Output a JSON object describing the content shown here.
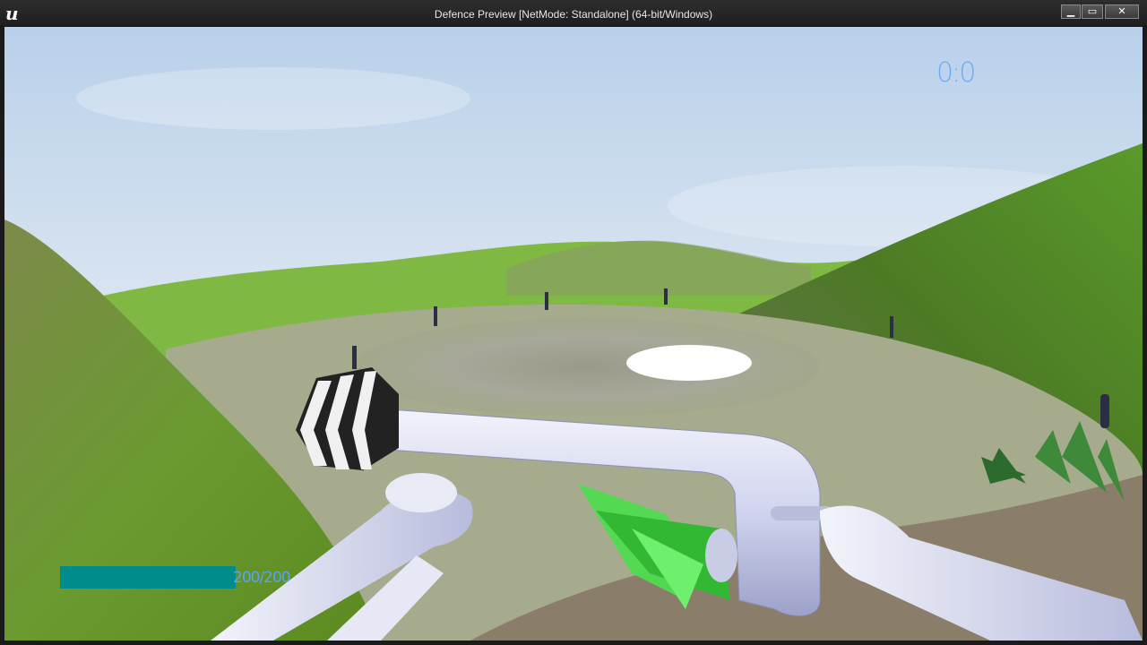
{
  "window": {
    "logo": "u",
    "title": "Defence Preview [NetMode: Standalone]  (64-bit/Windows)",
    "minimize_glyph": "▁",
    "maximize_glyph": "▭",
    "close_glyph": "✕"
  },
  "hud": {
    "score": "0:0",
    "health_text": "200/200",
    "health_fraction": 1.0
  },
  "colors": {
    "sky_top": "#bcd2ea",
    "sky_bottom": "#e9eef3",
    "grass": "#6fa834",
    "hud_text": "#5aa8ff",
    "health_bar": "#008c8c",
    "weapon": "#d4d8f0"
  }
}
